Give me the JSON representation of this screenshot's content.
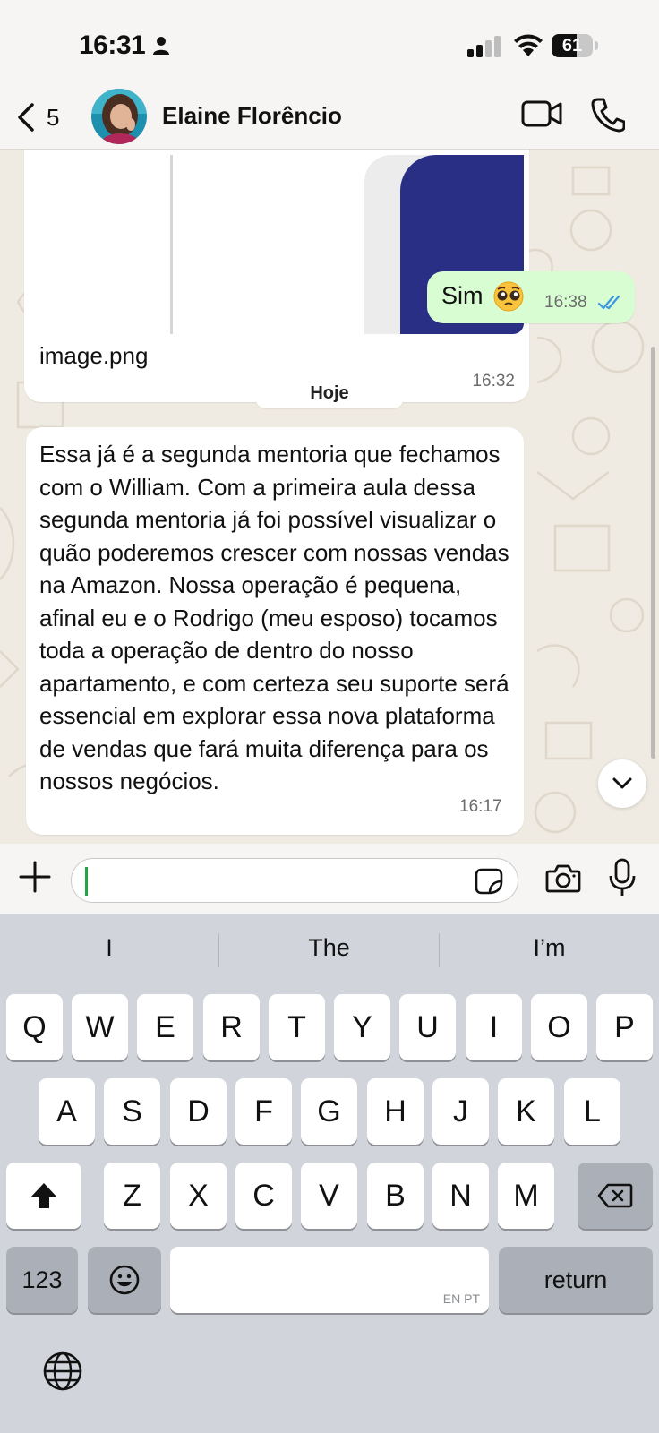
{
  "status_bar": {
    "time": "16:31",
    "battery_percent": "61",
    "battery_level": 0.61,
    "icons": [
      "person-icon",
      "signal-icon",
      "wifi-icon",
      "battery-icon"
    ]
  },
  "header": {
    "back_count": "5",
    "contact_name": "Elaine Florêncio",
    "icons": [
      "chevron-left-icon",
      "video-camera-icon",
      "phone-icon"
    ]
  },
  "messages": {
    "image_message": {
      "file_name": "image.png",
      "time": "16:32"
    },
    "outgoing": {
      "text": "Sim",
      "emoji": "🥺",
      "time": "16:38",
      "status": "read"
    },
    "day_separator": "Hoje",
    "incoming": {
      "text": "Essa já é a segunda mentoria que fechamos com o William. Com a primeira aula dessa segunda mentoria já foi possível visualizar o quão poderemos crescer com nossas vendas na Amazon. Nossa operação é pequena, afinal eu e o Rodrigo (meu esposo) tocamos toda a operação de dentro do nosso apartamento, e com certeza seu suporte será essencial em explorar essa nova plataforma de vendas que fará muita diferença para os nossos negócios.",
      "time": "16:17"
    }
  },
  "input_bar": {
    "placeholder": "",
    "icons": [
      "plus-icon",
      "sticker-icon",
      "camera-icon",
      "microphone-icon"
    ]
  },
  "keyboard": {
    "suggestions": [
      "I",
      "The",
      "I’m"
    ],
    "row1": [
      "Q",
      "W",
      "E",
      "R",
      "T",
      "Y",
      "U",
      "I",
      "O",
      "P"
    ],
    "row2": [
      "A",
      "S",
      "D",
      "F",
      "G",
      "H",
      "J",
      "K",
      "L"
    ],
    "row3": [
      "Z",
      "X",
      "C",
      "V",
      "B",
      "N",
      "M"
    ],
    "numbers_key": "123",
    "space_hint": "EN PT",
    "return_key": "return",
    "icons": [
      "shift-icon",
      "backspace-icon",
      "emoji-icon",
      "globe-icon"
    ]
  }
}
